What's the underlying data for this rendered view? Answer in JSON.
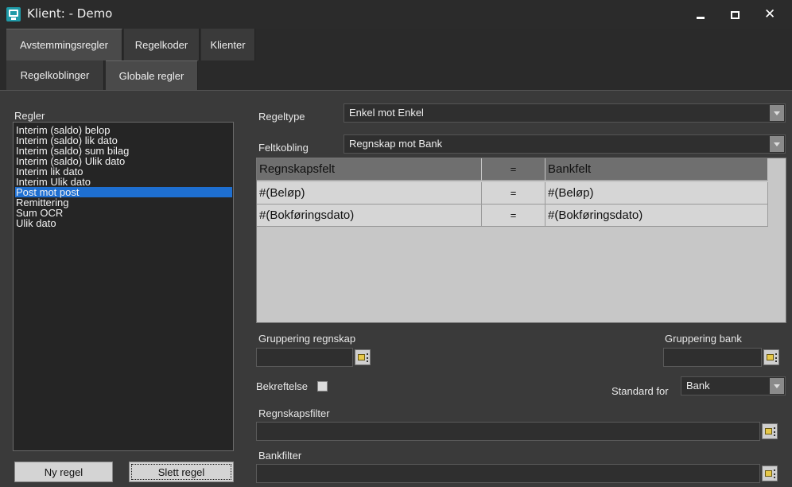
{
  "window": {
    "title": "Klient:  - Demo"
  },
  "tabs_top": [
    "Avstemmingsregler",
    "Regelkoder",
    "Klienter"
  ],
  "tabs_sub": [
    "Regelkoblinger",
    "Globale regler"
  ],
  "left": {
    "label": "Regler",
    "items": [
      "Interim (saldo) belop",
      "Interim (saldo) lik dato",
      "Interim (saldo) sum bilag",
      "Interim (saldo) Ulik dato",
      "Interim lik dato",
      "Interim Ulik dato",
      "Post mot post",
      "Remittering",
      "Sum OCR",
      "Ulik dato"
    ],
    "selected_index": 6,
    "new_button": "Ny regel",
    "delete_button": "Slett regel"
  },
  "form": {
    "regeltype_label": "Regeltype",
    "regeltype_value": "Enkel mot Enkel",
    "feltkobling_label": "Feltkobling",
    "feltkobling_value": "Regnskap mot Bank",
    "grid": {
      "headers": [
        "Regnskapsfelt",
        "=",
        "Bankfelt"
      ],
      "rows": [
        [
          "#(Beløp)",
          "=",
          "#(Beløp)"
        ],
        [
          "#(Bokføringsdato)",
          "=",
          "#(Bokføringsdato)"
        ]
      ]
    },
    "gruppering_regnskap_label": "Gruppering regnskap",
    "gruppering_bank_label": "Gruppering bank",
    "bekreftelse_label": "Bekreftelse",
    "standard_for_label": "Standard for",
    "standard_for_value": "Bank",
    "regnskapsfilter_label": "Regnskapsfilter",
    "bankfilter_label": "Bankfilter"
  },
  "icons": {
    "app": "app-icon",
    "picker": "picker-icon",
    "dropdown": "chevron-down-icon"
  }
}
